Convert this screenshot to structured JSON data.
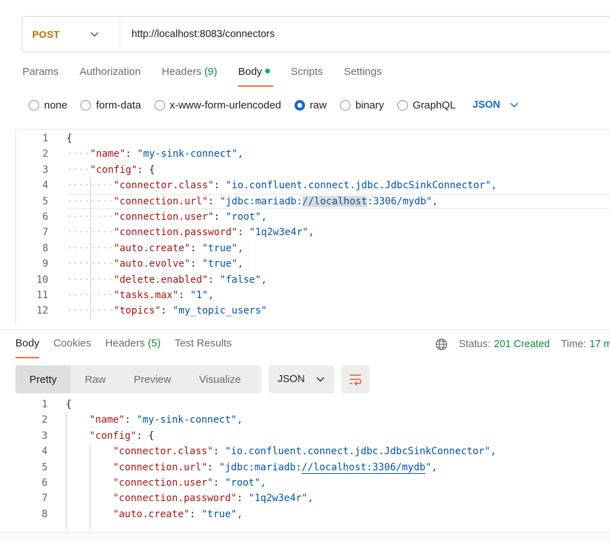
{
  "request": {
    "method": "POST",
    "url": "http://localhost:8083/connectors"
  },
  "request_tabs": [
    {
      "label": "Params"
    },
    {
      "label": "Authorization"
    },
    {
      "label": "Headers",
      "count": "(9)"
    },
    {
      "label": "Body",
      "active": true
    },
    {
      "label": "Scripts"
    },
    {
      "label": "Settings"
    }
  ],
  "body_types": [
    {
      "label": "none"
    },
    {
      "label": "form-data"
    },
    {
      "label": "x-www-form-urlencoded"
    },
    {
      "label": "raw",
      "selected": true
    },
    {
      "label": "binary"
    },
    {
      "label": "GraphQL"
    }
  ],
  "body_format": "JSON",
  "request_body": {
    "lines": [
      {
        "n": "1",
        "indent": 0,
        "text": "{"
      },
      {
        "n": "2",
        "indent": 1,
        "key": "\"name\"",
        "value": "\"my-sink-connect\","
      },
      {
        "n": "3",
        "indent": 1,
        "key": "\"config\"",
        "value": "{"
      },
      {
        "n": "4",
        "indent": 2,
        "key": "\"connector.class\"",
        "value": "\"io.confluent.connect.jdbc.JdbcSinkConnector\","
      },
      {
        "n": "5",
        "indent": 2,
        "key": "\"connection.url\"",
        "value_parts": [
          "\"jdbc:mariadb:",
          "//localhost",
          ":3306/mydb\","
        ]
      },
      {
        "n": "6",
        "indent": 2,
        "key": "\"connection.user\"",
        "value": "\"root\","
      },
      {
        "n": "7",
        "indent": 2,
        "key": "\"connection.password\"",
        "value": "\"1q2w3e4r\","
      },
      {
        "n": "8",
        "indent": 2,
        "key": "\"auto.create\"",
        "value": "\"true\","
      },
      {
        "n": "9",
        "indent": 2,
        "key": "\"auto.evolve\"",
        "value": "\"true\","
      },
      {
        "n": "10",
        "indent": 2,
        "key": "\"delete.enabled\"",
        "value": "\"false\","
      },
      {
        "n": "11",
        "indent": 2,
        "key": "\"tasks.max\"",
        "value": "\"1\","
      },
      {
        "n": "12",
        "indent": 2,
        "key": "\"topics\"",
        "value": "\"my_topic_users\""
      }
    ]
  },
  "response_tabs": [
    {
      "label": "Body",
      "active": true
    },
    {
      "label": "Cookies"
    },
    {
      "label": "Headers",
      "count": "(5)"
    },
    {
      "label": "Test Results"
    }
  ],
  "response_status": {
    "label": "Status:",
    "value": "201 Created",
    "time_label": "Time:",
    "time_value": "17 m"
  },
  "response_views": [
    {
      "label": "Pretty",
      "active": true
    },
    {
      "label": "Raw"
    },
    {
      "label": "Preview"
    },
    {
      "label": "Visualize"
    }
  ],
  "response_format": "JSON",
  "response_body": {
    "lines": [
      {
        "n": "1",
        "indent": 0,
        "text": "{"
      },
      {
        "n": "2",
        "indent": 1,
        "key": "\"name\"",
        "value": "\"my-sink-connect\","
      },
      {
        "n": "3",
        "indent": 1,
        "key": "\"config\"",
        "value": "{"
      },
      {
        "n": "4",
        "indent": 2,
        "key": "\"connector.class\"",
        "value": "\"io.confluent.connect.jdbc.JdbcSinkConnector\","
      },
      {
        "n": "5",
        "indent": 2,
        "key": "\"connection.url\"",
        "value_parts": [
          "\"jdbc:mariadb:",
          "//localhost:3306/mydb",
          "\","
        ]
      },
      {
        "n": "6",
        "indent": 2,
        "key": "\"connection.user\"",
        "value": "\"root\","
      },
      {
        "n": "7",
        "indent": 2,
        "key": "\"connection.password\"",
        "value": "\"1q2w3e4r\","
      },
      {
        "n": "8",
        "indent": 2,
        "key": "\"auto.create\"",
        "value": "\"true\","
      }
    ]
  },
  "colors": {
    "accent": "#ff6c37",
    "method": "#a8730d",
    "link": "#1366d6",
    "success": "#0a8a3a",
    "json_key": "#a31515",
    "json_string": "#0451a5"
  }
}
